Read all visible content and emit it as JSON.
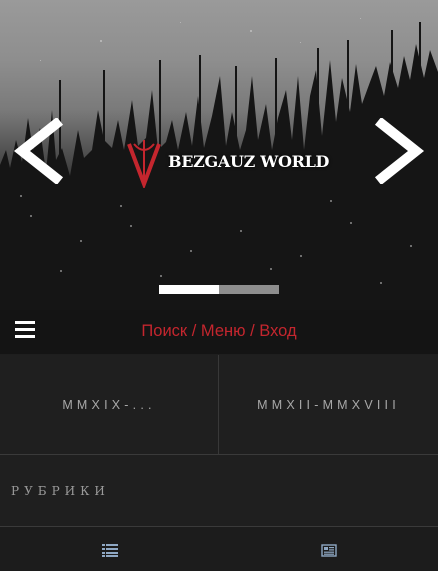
{
  "site": {
    "brand": "BEZGAUZ WORLD",
    "accent": "#c4262e"
  },
  "hero": {
    "prev_icon": "chevron-left-icon",
    "next_icon": "chevron-right-icon",
    "logo_icon": "brand-v-logo-icon",
    "slider_progress": 0.5
  },
  "nav": {
    "menu_icon": "hamburger-menu-icon",
    "search": "Поиск",
    "sep": " / ",
    "menu": "Меню",
    "login": "Вход"
  },
  "grid": {
    "left": "MMXIX-...",
    "right": "MMXII-MMXVIII",
    "full": "РУБРИКИ"
  },
  "bottom": {
    "left_icon": "list-icon",
    "right_icon": "newspaper-icon"
  }
}
